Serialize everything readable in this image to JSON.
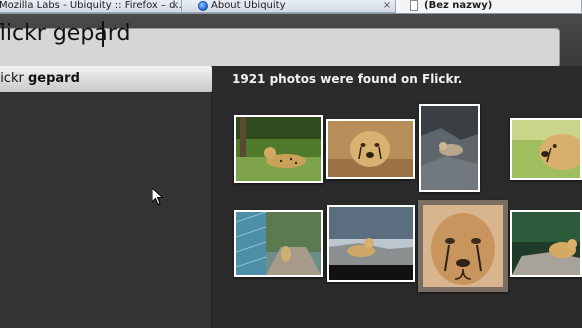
{
  "tabs": [
    {
      "label": "Mozilla Labs - Ubiquity :: Firefox – d...",
      "close": "×",
      "active": false
    },
    {
      "label": "About Ubiquity",
      "close": "×",
      "active": false
    },
    {
      "label": "(Bez nazwy)",
      "close": "",
      "active": true
    }
  ],
  "command": {
    "input_text": "flickr gepard"
  },
  "suggestions": [
    {
      "prefix": "flickr ",
      "argument": "gepard",
      "selected": true
    }
  ],
  "preview": {
    "message": "1921 photos were found on Flickr.",
    "photos": [
      {
        "subject": "cheetah lying on grass"
      },
      {
        "subject": "cheetah face close-up"
      },
      {
        "subject": "cheetah on rocks"
      },
      {
        "subject": "cheetah head profile"
      },
      {
        "subject": "cheetah in enclosure"
      },
      {
        "subject": "cheetah on road"
      },
      {
        "subject": "cheetah face painting"
      },
      {
        "subject": "cheetah on rock"
      }
    ]
  },
  "colors": {
    "background": "#2b2b2b",
    "input_bg": "#d6d6d6",
    "message_text": "#f2f2f2"
  }
}
